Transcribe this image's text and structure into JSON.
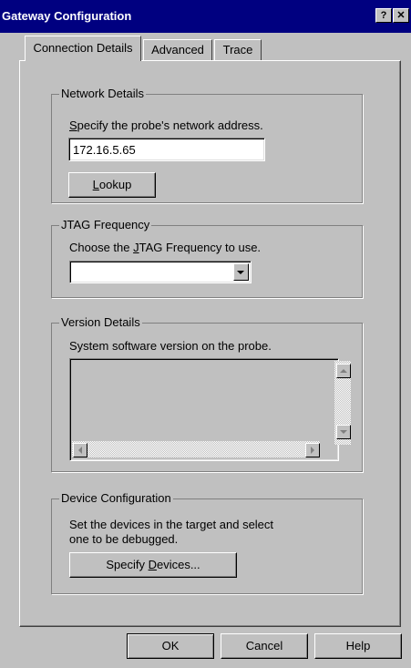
{
  "window": {
    "title": "Gateway Configuration",
    "help_btn": "?",
    "close_btn": "✕"
  },
  "tabs": [
    {
      "label": "Connection Details",
      "active": true
    },
    {
      "label": "Advanced",
      "active": false
    },
    {
      "label": "Trace",
      "active": false
    }
  ],
  "network": {
    "legend": "Network Details",
    "prompt_ul": "S",
    "prompt_rest": "pecify the probe's network address.",
    "address": "172.16.5.65",
    "lookup_ul": "L",
    "lookup_rest": "ookup"
  },
  "jtag": {
    "legend": "JTAG Frequency",
    "prompt_pre": "Choose the ",
    "prompt_ul": "J",
    "prompt_post": "TAG Frequency to use.",
    "selected": ""
  },
  "version": {
    "legend": "Version Details",
    "prompt": "System software version on the probe.",
    "content": ""
  },
  "device": {
    "legend": "Device Configuration",
    "line1": "Set the devices in the target and select",
    "line2": "one to be debugged.",
    "btn_pre": "Specify ",
    "btn_ul": "D",
    "btn_post": "evices..."
  },
  "footer": {
    "ok": "OK",
    "cancel": "Cancel",
    "help": "Help"
  }
}
